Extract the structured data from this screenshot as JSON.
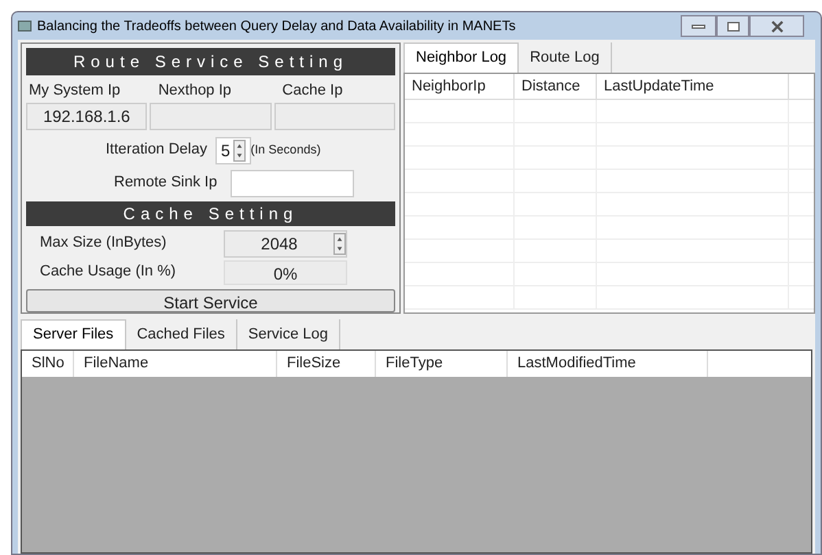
{
  "window": {
    "title": "Balancing the Tradeoffs between Query Delay and Data Availability in MANETs"
  },
  "route_service": {
    "heading": "Route Service Setting",
    "ip_fields": [
      {
        "label": "My System Ip",
        "value": "192.168.1.6"
      },
      {
        "label": "Nexthop Ip"
      },
      {
        "label": "Cache Ip"
      }
    ],
    "iteration_delay": {
      "label": "Itteration Delay",
      "value": "5",
      "unit": "(In Seconds)"
    },
    "remote_sink": {
      "label": "Remote Sink Ip"
    }
  },
  "cache_setting": {
    "heading": "Cache Setting",
    "max_size": {
      "label": "Max Size (InBytes)",
      "value": "2048"
    },
    "cache_usage": {
      "label": "Cache Usage (In %)",
      "value": "0%"
    }
  },
  "start_button": "Start Service",
  "log_tabs": [
    {
      "label": "Neighbor Log",
      "selected": true
    },
    {
      "label": "Route Log",
      "selected": false
    }
  ],
  "neighbor_table": {
    "columns": [
      "NeighborIp",
      "Distance",
      "LastUpdateTime"
    ]
  },
  "file_tabs": [
    {
      "label": "Server Files",
      "selected": true
    },
    {
      "label": "Cached Files",
      "selected": false
    },
    {
      "label": "Service Log",
      "selected": false
    }
  ],
  "files_table": {
    "columns": [
      "SlNo",
      "FileName",
      "FileSize",
      "FileType",
      "LastModifiedTime"
    ]
  }
}
